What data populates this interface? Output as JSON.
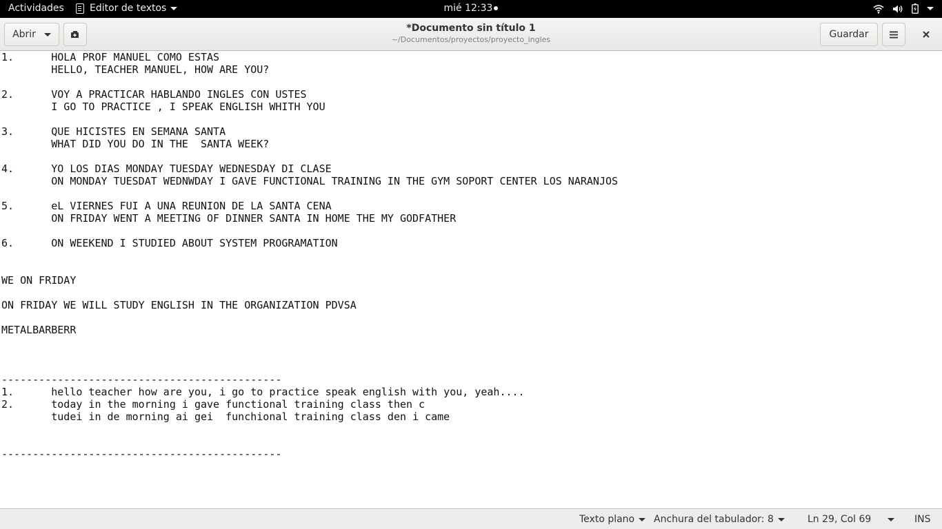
{
  "topbar": {
    "activities": "Actividades",
    "app_name": "Editor de textos",
    "clock": "mié 12:33"
  },
  "header": {
    "open_label": "Abrir",
    "title": "*Documento sin título 1",
    "path": "~/Documentos/proyectos/proyecto_ingles",
    "save_label": "Guardar"
  },
  "document": {
    "lines": [
      "1.\tHOLA PROF MANUEL COMO ESTAS",
      "\tHELLO, TEACHER MANUEL, HOW ARE YOU?",
      "",
      "2.\tVOY A PRACTICAR HABLANDO INGLES CON USTES",
      "\tI GO TO PRACTICE , I SPEAK ENGLISH WHITH YOU",
      "",
      "3.\tQUE HICISTES EN SEMANA SANTA",
      "\tWHAT DID YOU DO IN THE  SANTA WEEK?",
      "",
      "4.\tYO LOS DIAS MONDAY TUESDAY WEDNESDAY DI CLASE",
      "\tON MONDAY TUESDAT WEDNWDAY I GAVE FUNCTIONAL TRAINING IN THE GYM SOPORT CENTER LOS NARANJOS",
      "",
      "5.\teL VIERNES FUI A UNA REUNION DE LA SANTA CENA",
      "\tON FRIDAY WENT A MEETING OF DINNER SANTA IN HOME THE MY GODFATHER",
      "",
      "6.\tON WEEKEND I STUDIED ABOUT SYSTEM PROGRAMATION",
      "",
      "",
      "WE ON FRIDAY",
      "",
      "ON FRIDAY WE WILL STUDY ENGLISH IN THE ORGANIZATION PDVSA",
      "",
      "METALBARBERR",
      "",
      "",
      "",
      "---------------------------------------------",
      "1.\thello teacher how are you, i go to practice speak english with you, yeah....",
      "2.\ttoday in the morning i gave functional training class then c",
      "\ttudei in de morning ai gei  funchional training class den i came",
      "",
      "",
      "---------------------------------------------"
    ]
  },
  "statusbar": {
    "language": "Texto plano",
    "tab_width": "Anchura del tabulador: 8",
    "position": "Ln 29, Col 69",
    "mode": "INS"
  }
}
